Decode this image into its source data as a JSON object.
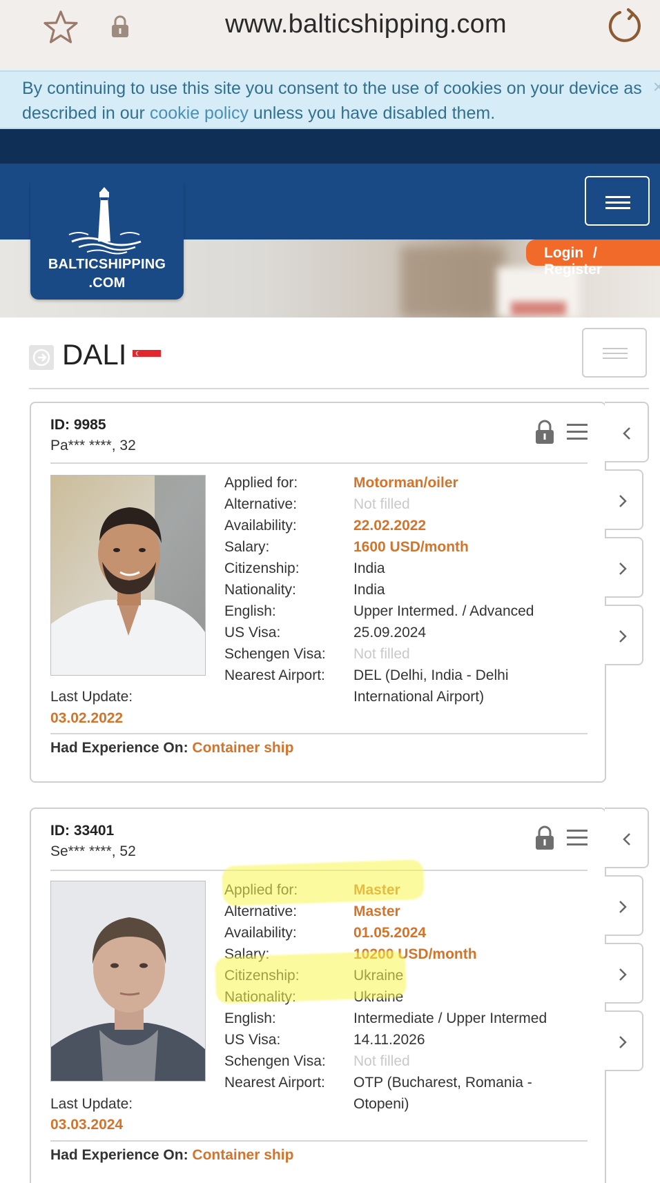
{
  "browser": {
    "url": "www.balticshipping.com",
    "icons": [
      "star-icon",
      "lock-icon",
      "reload-icon"
    ]
  },
  "cookie_banner": {
    "text_before": "By continuing to use this site you consent to the use of cookies on your device as described in our ",
    "link": "cookie policy",
    "text_after": " unless you have disabled them.",
    "close": "×"
  },
  "header": {
    "logo_line1": "BALTICSHIPPING",
    "logo_line2": ".COM",
    "login": "Login",
    "separator": "/",
    "register": "Register"
  },
  "ship": {
    "name": "DALI"
  },
  "colors": {
    "accent": "#d2742b",
    "header_blue": "#1a4a86",
    "login_orange": "#f26a2a"
  },
  "candidates": [
    {
      "id": "ID: 9985",
      "person": "Pa*** ****, 32",
      "fields": [
        {
          "label": "Applied for:",
          "value": "Motorman/oiler",
          "style": "hl"
        },
        {
          "label": "Alternative:",
          "value": "Not filled",
          "style": "muted"
        },
        {
          "label": "Availability:",
          "value": "22.02.2022",
          "style": "hl"
        },
        {
          "label": "Salary:",
          "value": "1600 USD/month",
          "style": "hl"
        },
        {
          "label": "Citizenship:",
          "value": "India",
          "style": ""
        },
        {
          "label": "Nationality:",
          "value": "India",
          "style": ""
        },
        {
          "label": "English:",
          "value": "Upper Intermed. / Advanced",
          "style": ""
        },
        {
          "label": "US Visa:",
          "value": "25.09.2024",
          "style": ""
        },
        {
          "label": "Schengen Visa:",
          "value": "Not filled",
          "style": "muted"
        },
        {
          "label": "Nearest Airport:",
          "value": "DEL (Delhi, India - Delhi International Airport)",
          "style": ""
        }
      ],
      "last_update_label": "Last Update:",
      "last_update": "03.02.2022",
      "experience_label": "Had Experience On:",
      "experience": "Container ship"
    },
    {
      "id": "ID: 33401",
      "person": "Se*** ****, 52",
      "fields": [
        {
          "label": "Applied for:",
          "value": "Master",
          "style": "hl"
        },
        {
          "label": "Alternative:",
          "value": "Master",
          "style": "hl"
        },
        {
          "label": "Availability:",
          "value": "01.05.2024",
          "style": "hl"
        },
        {
          "label": "Salary:",
          "value": "10200 USD/month",
          "style": "hl"
        },
        {
          "label": "Citizenship:",
          "value": "Ukraine",
          "style": ""
        },
        {
          "label": "Nationality:",
          "value": "Ukraine",
          "style": ""
        },
        {
          "label": "English:",
          "value": "Intermediate / Upper Intermed",
          "style": ""
        },
        {
          "label": "US Visa:",
          "value": "14.11.2026",
          "style": ""
        },
        {
          "label": "Schengen Visa:",
          "value": "Not filled",
          "style": "muted"
        },
        {
          "label": "Nearest Airport:",
          "value": "OTP (Bucharest, Romania - Otopeni)",
          "style": ""
        }
      ],
      "last_update_label": "Last Update:",
      "last_update": "03.03.2024",
      "experience_label": "Had Experience On:",
      "experience": "Container ship"
    }
  ]
}
